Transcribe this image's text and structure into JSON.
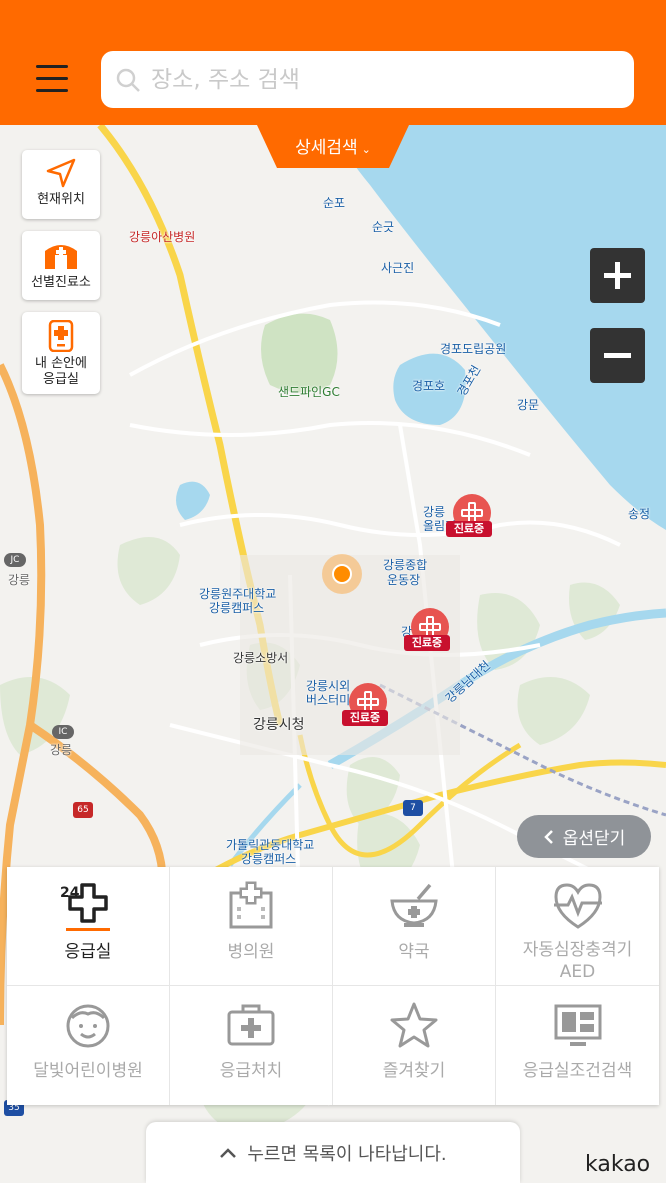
{
  "header": {
    "search_placeholder": "장소, 주소 검색",
    "detail_search_label": "상세검색"
  },
  "side_buttons": {
    "current_location": "현재위치",
    "screening_clinic": "선별진료소",
    "er_in_hand_line1": "내 손안에",
    "er_in_hand_line2": "응급실"
  },
  "map_labels": {
    "asan_hospital": "강릉아산병원",
    "sunpo": "순포",
    "sungut": "순긋",
    "sageunjin": "사근진",
    "gyeongpo_park": "경포도립공원",
    "sandpine": "샌드파인GC",
    "gyeongpoho": "경포호",
    "gyeongpocheon": "경포천",
    "gangmun": "강문",
    "songjeong": "송정",
    "olympic_park_1": "강릉",
    "olympic_park_2": "올림픽",
    "sports_complex_1": "강릉종합",
    "sports_complex_2": "운동장",
    "wonju_univ_1": "강릉원주대학교",
    "wonju_univ_2": "강릉캠퍼스",
    "fire_station": "강릉소방서",
    "bus_terminal_1": "강릉시외",
    "bus_terminal_2": "버스터미",
    "city_hall": "강릉시청",
    "namdaecheon": "강릉남대천",
    "gangneung_jc": "강릉",
    "gangneung_ic": "강릉",
    "catholic_univ_1": "가톨릭관동대학교",
    "catholic_univ_2": "강릉캠퍼스",
    "gang_short": "강",
    "road_65": "65",
    "road_7": "7",
    "road_35": "35",
    "jc": "JC",
    "ic": "IC"
  },
  "pins": {
    "status": "진료중"
  },
  "zoom": {
    "in": "+",
    "out": "−"
  },
  "option_close": "옵션닫기",
  "categories": [
    {
      "label": "응급실",
      "badge": "24"
    },
    {
      "label": "병의원"
    },
    {
      "label": "약국"
    },
    {
      "label": "자동심장충격기",
      "label2": "AED"
    },
    {
      "label": "달빛어린이병원"
    },
    {
      "label": "응급처치"
    },
    {
      "label": "즐겨찾기"
    },
    {
      "label": "응급실조건검색"
    }
  ],
  "list_toggle": "누르면 목록이 나타납니다.",
  "brand": "kakao",
  "colors": {
    "header": "#ff6a00",
    "sea": "#a6d8ee",
    "pin_red": "#e53935"
  }
}
